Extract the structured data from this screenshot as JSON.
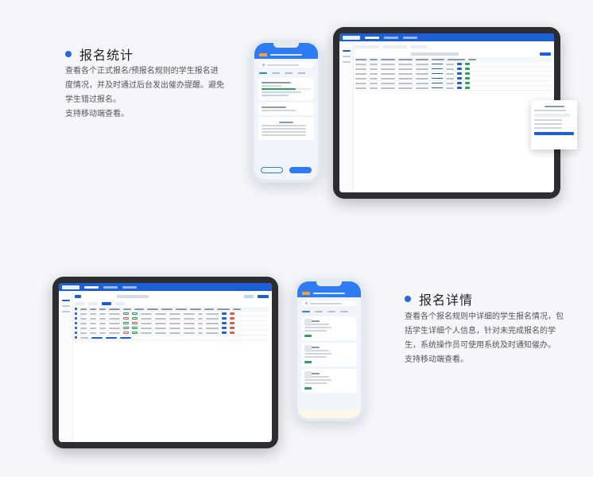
{
  "sections": [
    {
      "title": "报名统计",
      "desc": [
        "查看各个正式报名/预报名规则的学生报名进",
        "度情况，并及时通过后台发出催办提醒。避免",
        "学生错过报名。",
        "支持移动端查看。"
      ]
    },
    {
      "title": "报名详情",
      "desc": [
        "查看各个报名规则中详细的学生报名情况，包",
        "括学生详细个人信息，针对未完成报名的学",
        "生，系统操作员可使用系统及时通知催办。",
        "支持移动端查看。"
      ]
    }
  ],
  "colors": {
    "accent": "#2b66d9",
    "success": "#27a35a",
    "danger": "#e05b4c",
    "mobile_header": "#2f7cf2",
    "warn": "#ff9b2f"
  }
}
